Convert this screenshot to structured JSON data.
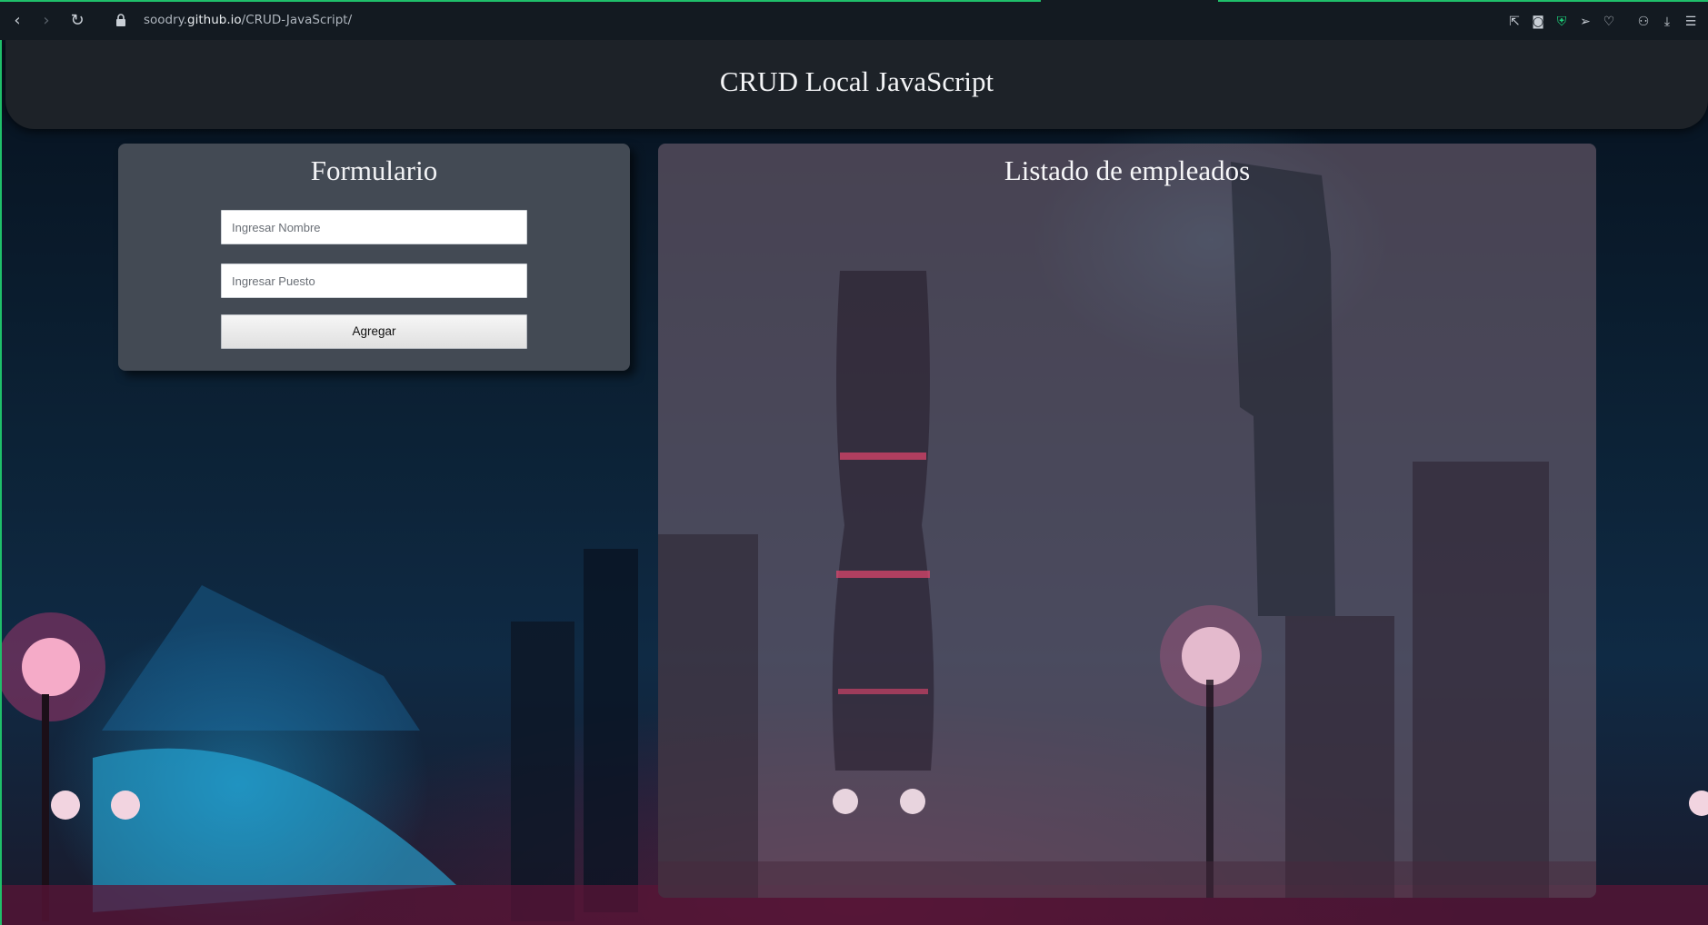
{
  "browser": {
    "url_prefix": "soodry.",
    "url_host": "github.io",
    "url_path": "/CRUD-JavaScript/",
    "icons": [
      "back-icon",
      "forward-icon",
      "reload-icon",
      "lock-icon",
      "share-icon",
      "camera-icon",
      "shield-icon",
      "send-icon",
      "heart-icon",
      "account-icon",
      "download-icon",
      "menu-icon"
    ]
  },
  "header": {
    "title": "CRUD Local JavaScript"
  },
  "form": {
    "title": "Formulario",
    "name_placeholder": "Ingresar Nombre",
    "name_value": "",
    "position_placeholder": "Ingresar Puesto",
    "position_value": "",
    "submit_label": "Agregar"
  },
  "list": {
    "title": "Listado de empleados",
    "employees": []
  },
  "colors": {
    "header_bg": "#1d2228",
    "form_card_bg": "#434a54",
    "list_card_bg": "#70607088",
    "browser_accent": "#1fbf6a"
  }
}
